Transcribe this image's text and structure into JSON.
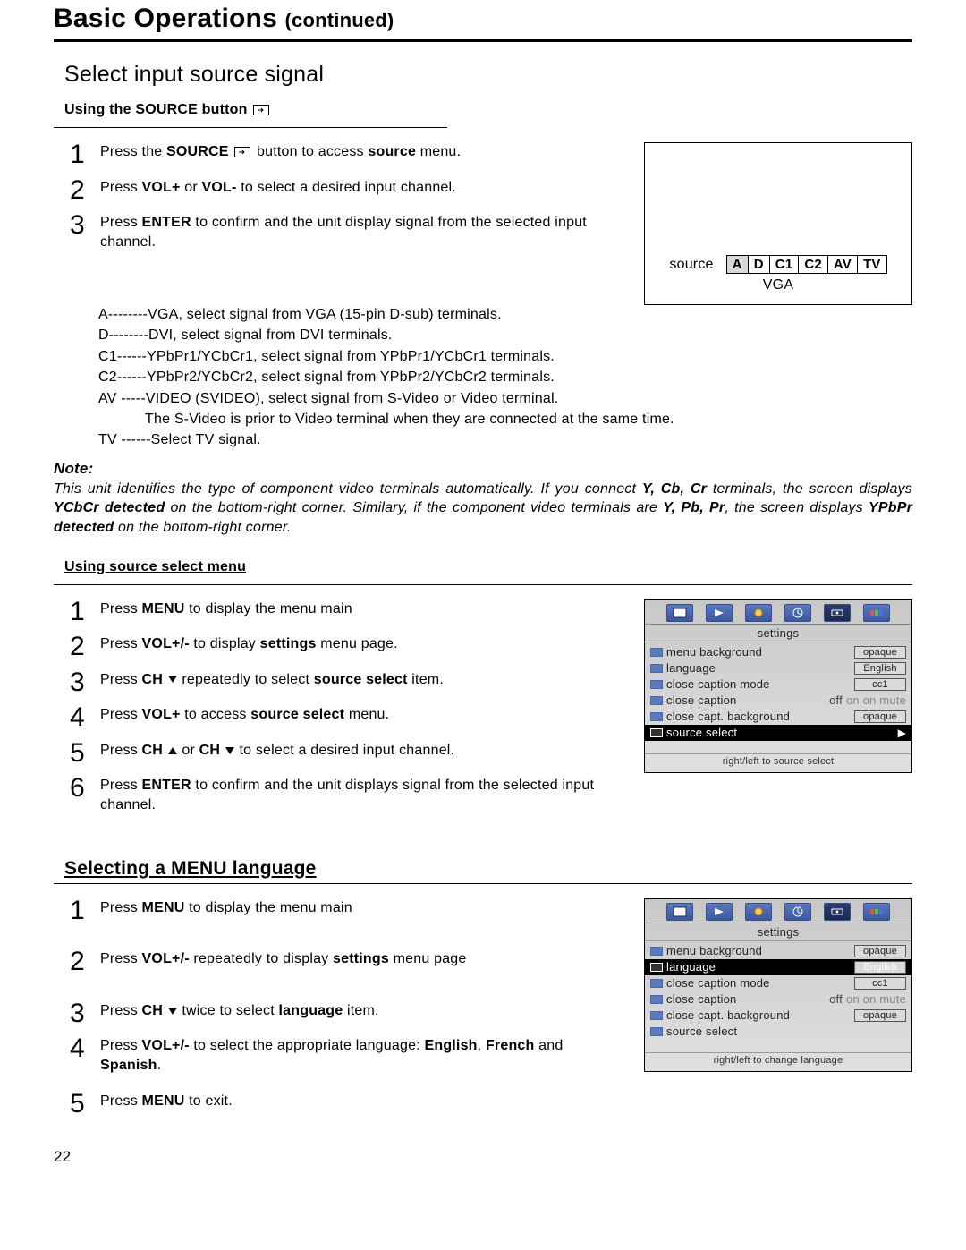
{
  "title": "Basic Operations",
  "title_cont": "(continued)",
  "section1": {
    "heading": "Select input source signal",
    "sub_a": "Using the SOURCE      button",
    "steps_a": [
      {
        "pre": "Press the ",
        "b1": "SOURCE",
        "post": "      button to access ",
        "b2": "source",
        "tail": " menu."
      },
      {
        "pre": "Press ",
        "b1": "VOL+",
        "mid": " or ",
        "b2": "VOL-",
        "tail": " to select a desired input channel."
      },
      {
        "pre": "Press ",
        "b1": "ENTER",
        "tail": " to confirm and the unit display signal from the selected input channel."
      }
    ],
    "defs": [
      "A--------VGA, select signal from VGA (15-pin D-sub) terminals.",
      "D--------DVI,  select signal from DVI terminals.",
      "C1------YPbPr1/YCbCr1, select signal from YPbPr1/YCbCr1 terminals.",
      "C2------YPbPr2/YCbCr2, select signal from YPbPr2/YCbCr2 terminals.",
      "AV -----VIDEO (SVIDEO), select signal from S-Video or Video terminal.",
      "The S-Video is prior to Video terminal when they are connected at the same time.",
      "TV ------Select TV signal."
    ],
    "note_label": "Note:",
    "note_parts": {
      "p1": "This unit identifies the type of component video terminals automatically. If you connect ",
      "b1": "Y, Cb, Cr",
      "p2": " terminals, the screen displays ",
      "b2": "YCbCr detected",
      "p3": "  on the bottom-right corner. Similary, if the component video terminals are ",
      "b3": "Y, Pb, Pr",
      "p4": ", the screen displays ",
      "b4": "YPbPr detected",
      "p5": "  on the bottom-right corner."
    },
    "src_fig": {
      "label": "source",
      "cells": [
        "A",
        "D",
        "C1",
        "C2",
        "AV",
        "TV"
      ],
      "active": "VGA"
    },
    "sub_b": "Using source select menu",
    "steps_b": [
      "Press  <b>MENU</b> to display the menu main",
      "Press  <b>VOL+/-</b> to display  <b>settings</b> menu page.",
      "Press  <b>CH</b> ▾ repeatedly to select  <b>source select</b>  item.",
      "Press  <b>VOL+</b> to access <b>source select</b> menu.",
      "Press <b>CH</b> ▴ or <b>CH</b> ▾ to select a desired input channel.",
      "Press <b>ENTER</b> to confirm and the unit displays signal from the selected input channel."
    ],
    "osd1": {
      "title": "settings",
      "items": [
        {
          "name": "menu background",
          "value": "opaque"
        },
        {
          "name": "language",
          "value": "English"
        },
        {
          "name": "close caption mode",
          "value": "cc1"
        },
        {
          "name": "close caption",
          "off": "off",
          "gray": "on   on mute"
        },
        {
          "name": "close capt. background",
          "value": "opaque"
        },
        {
          "name": "source select",
          "selected": true
        }
      ],
      "foot": "right/left to source select"
    }
  },
  "section2": {
    "heading": "Selecting a MENU language",
    "steps": [
      "Press  <b>MENU</b> to display the menu main",
      "Press <b>VOL+/-</b> repeatedly to display <b>settings</b> menu page",
      "Press <b>CH</b> ▾ twice  to select <b>language</b> item.",
      "Press <b>VOL+/-</b> to select the appropriate language: <b>English</b>, <b>French</b> and <b>Spanish</b>.",
      "Press <b>MENU</b> to exit."
    ],
    "osd2": {
      "title": "settings",
      "items": [
        {
          "name": "menu background",
          "value": "opaque"
        },
        {
          "name": "language",
          "value": "English",
          "selected": true
        },
        {
          "name": "close caption mode",
          "value": "cc1"
        },
        {
          "name": "close caption",
          "off": "off",
          "gray": "on   on mute"
        },
        {
          "name": "close capt. background",
          "value": "opaque"
        },
        {
          "name": "source select"
        }
      ],
      "foot": "right/left to change language"
    }
  },
  "page_number": "22"
}
